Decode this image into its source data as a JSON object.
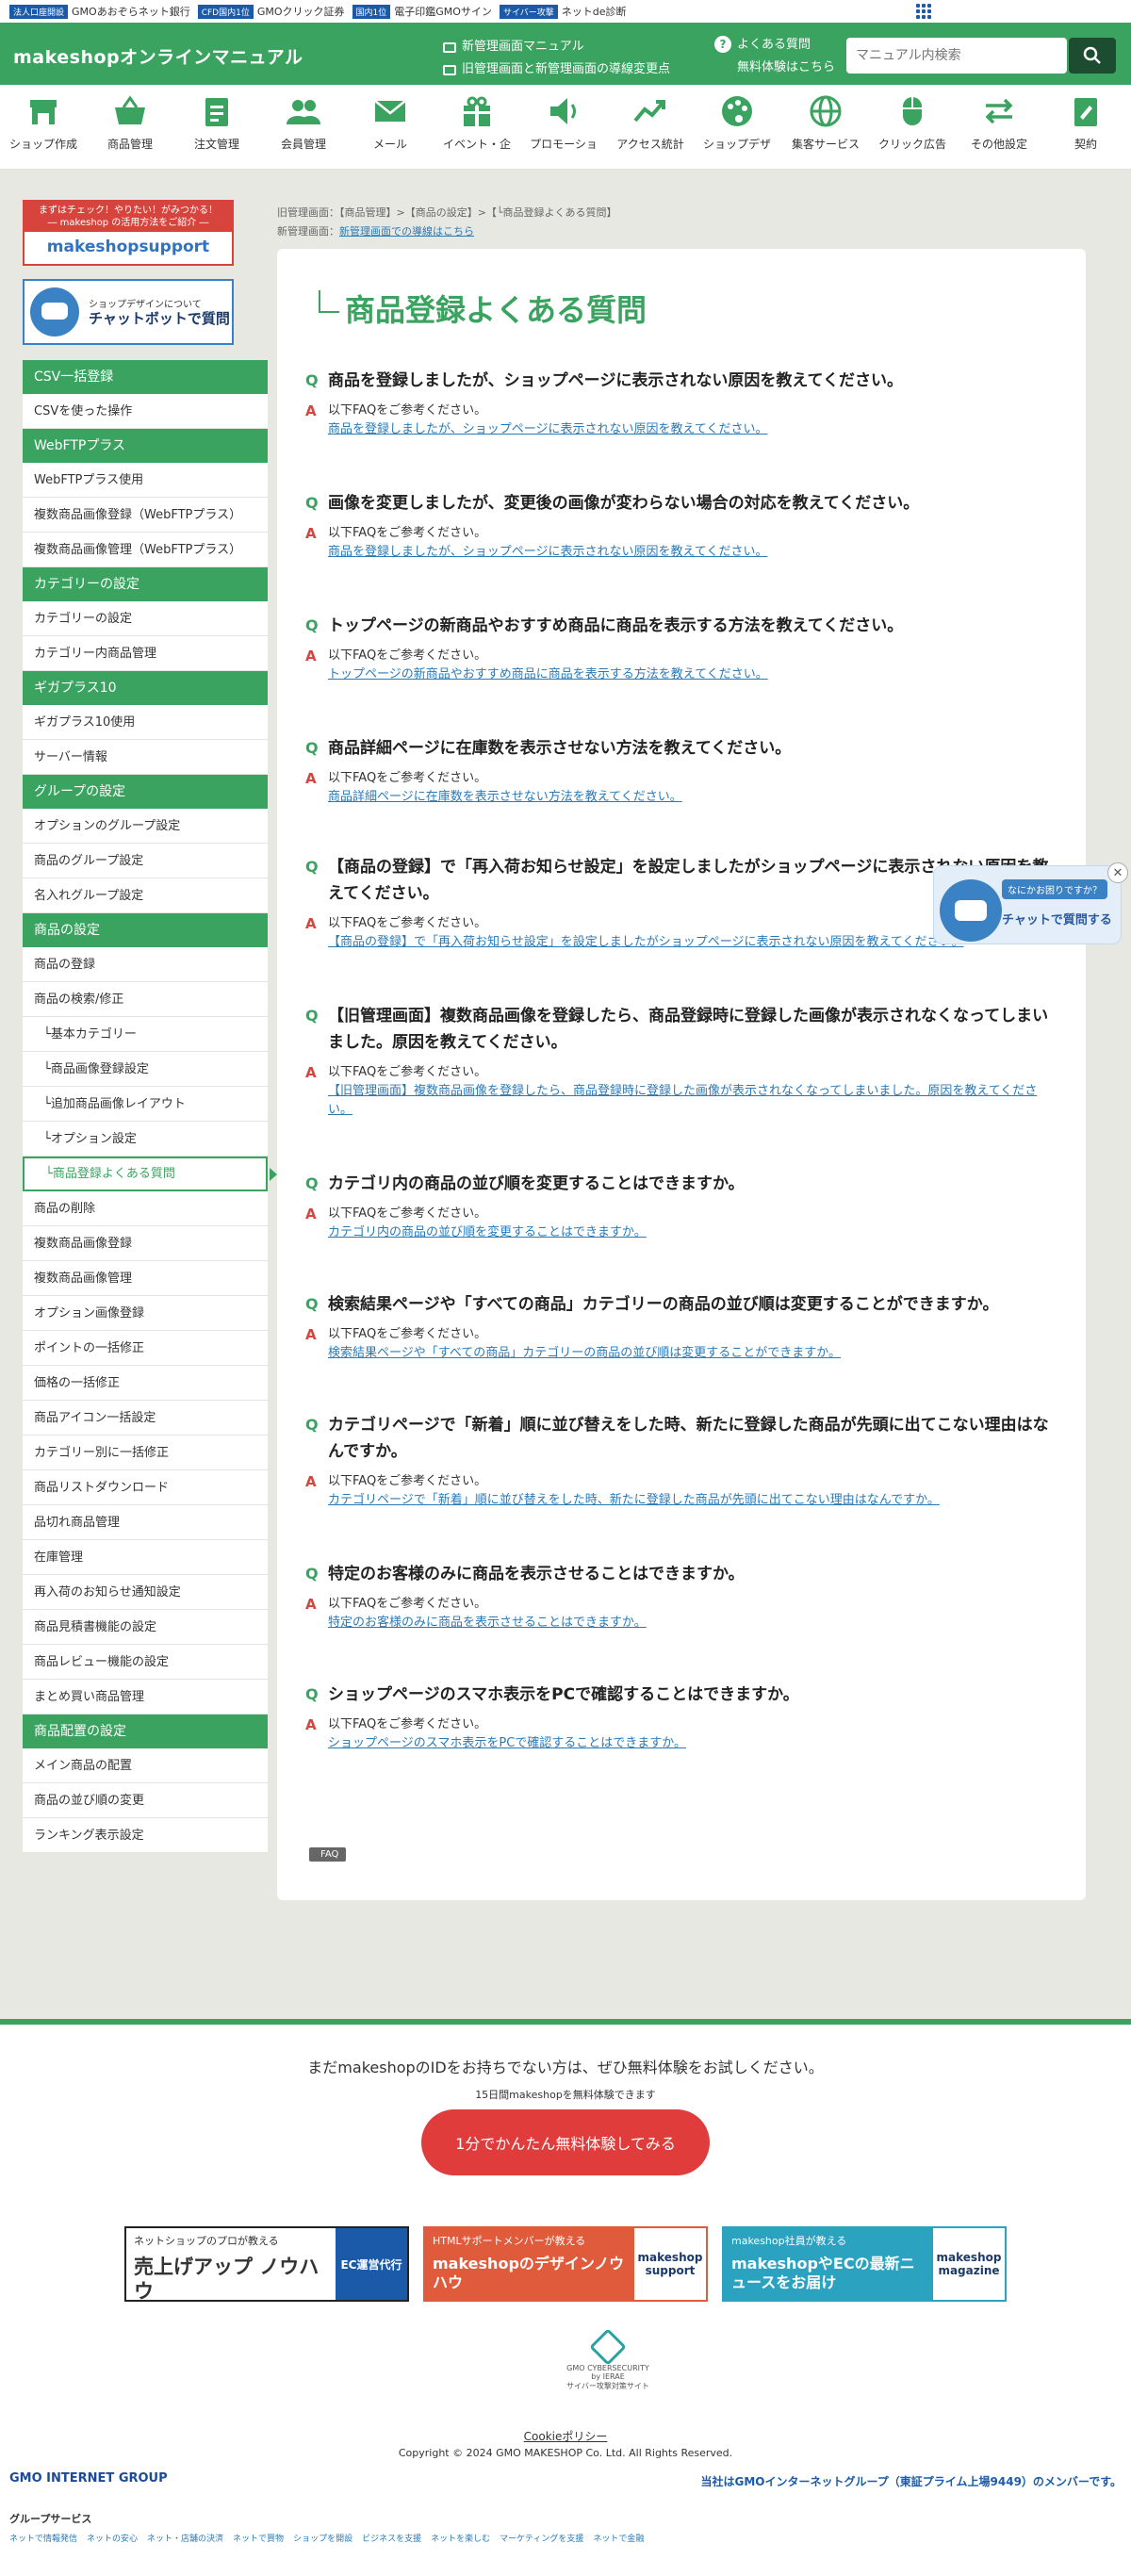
{
  "gmobar": {
    "items": [
      {
        "tag": "法人口座開設",
        "label": "GMOあおぞらネット銀行"
      },
      {
        "tag": "CFD国内1位",
        "label": "GMOクリック証券"
      },
      {
        "tag": "国内1位",
        "label": "電子印鑑GMOサイン"
      },
      {
        "tag": "サイバー攻撃",
        "label": "ネットde診断"
      }
    ]
  },
  "header": {
    "logo": "makeshopオンラインマニュアル",
    "link1": "新管理画面マニュアル",
    "link2": "旧管理画面と新管理画面の導線変更点",
    "faq": "よくある質問",
    "trial": "無料体験はこちら",
    "search_placeholder": "マニュアル内検索"
  },
  "nav": [
    {
      "label": "ショップ作成",
      "icon": "shop-icon"
    },
    {
      "label": "商品管理",
      "icon": "basket-icon"
    },
    {
      "label": "注文管理",
      "icon": "clipboard-icon"
    },
    {
      "label": "会員管理",
      "icon": "users-icon"
    },
    {
      "label": "メール",
      "icon": "mail-icon"
    },
    {
      "label": "イベント・企",
      "icon": "gift-icon"
    },
    {
      "label": "プロモーショ",
      "icon": "speaker-icon"
    },
    {
      "label": "アクセス統計",
      "icon": "chart-icon"
    },
    {
      "label": "ショップデザ",
      "icon": "palette-icon"
    },
    {
      "label": "集客サービス",
      "icon": "globe-icon"
    },
    {
      "label": "クリック広告",
      "icon": "mouse-icon"
    },
    {
      "label": "その他設定",
      "icon": "arrows-icon"
    },
    {
      "label": "契約",
      "icon": "contract-icon"
    }
  ],
  "banners": {
    "b1_top": "まずはチェック！やりたい！がみつかる！",
    "b1_sub": "― makeshop の活用方法をご紹介 ―",
    "b1_brand": "makeshop",
    "b1_brand2": "support",
    "b2_line1": "ショップデザインについて",
    "b2_line2": "チャットボットで質問"
  },
  "sidebar": [
    {
      "type": "sec",
      "label": "CSV一括登録"
    },
    {
      "type": "itm",
      "label": "CSVを使った操作"
    },
    {
      "type": "sec",
      "label": "WebFTPプラス"
    },
    {
      "type": "itm",
      "label": "WebFTPプラス使用"
    },
    {
      "type": "itm",
      "label": "複数商品画像登録（WebFTPプラス）"
    },
    {
      "type": "itm",
      "label": "複数商品画像管理（WebFTPプラス）"
    },
    {
      "type": "sec",
      "label": "カテゴリーの設定"
    },
    {
      "type": "itm",
      "label": "カテゴリーの設定"
    },
    {
      "type": "itm",
      "label": "カテゴリー内商品管理"
    },
    {
      "type": "sec",
      "label": "ギガプラス10"
    },
    {
      "type": "itm",
      "label": "ギガプラス10使用"
    },
    {
      "type": "itm",
      "label": "サーバー情報"
    },
    {
      "type": "sec",
      "label": "グループの設定"
    },
    {
      "type": "itm",
      "label": "オプションのグループ設定"
    },
    {
      "type": "itm",
      "label": "商品のグループ設定"
    },
    {
      "type": "itm",
      "label": "名入れグループ設定"
    },
    {
      "type": "sec",
      "label": "商品の設定"
    },
    {
      "type": "itm",
      "label": "商品の登録"
    },
    {
      "type": "itm",
      "label": "商品の検索/修正"
    },
    {
      "type": "sub",
      "label": "└基本カテゴリー"
    },
    {
      "type": "sub",
      "label": "└商品画像登録設定"
    },
    {
      "type": "sub",
      "label": "└追加商品画像レイアウト"
    },
    {
      "type": "sub",
      "label": "└オプション設定"
    },
    {
      "type": "active",
      "label": "└商品登録よくある質問"
    },
    {
      "type": "itm",
      "label": "商品の削除"
    },
    {
      "type": "itm",
      "label": "複数商品画像登録"
    },
    {
      "type": "itm",
      "label": "複数商品画像管理"
    },
    {
      "type": "itm",
      "label": "オプション画像登録"
    },
    {
      "type": "itm",
      "label": "ポイントの一括修正"
    },
    {
      "type": "itm",
      "label": "価格の一括修正"
    },
    {
      "type": "itm",
      "label": "商品アイコン一括設定"
    },
    {
      "type": "itm",
      "label": "カテゴリー別に一括修正"
    },
    {
      "type": "itm",
      "label": "商品リストダウンロード"
    },
    {
      "type": "itm",
      "label": "品切れ商品管理"
    },
    {
      "type": "itm",
      "label": "在庫管理"
    },
    {
      "type": "itm",
      "label": "再入荷のお知らせ通知設定"
    },
    {
      "type": "itm",
      "label": "商品見積書機能の設定"
    },
    {
      "type": "itm",
      "label": "商品レビュー機能の設定"
    },
    {
      "type": "itm",
      "label": "まとめ買い商品管理"
    },
    {
      "type": "sec",
      "label": "商品配置の設定"
    },
    {
      "type": "itm",
      "label": "メイン商品の配置"
    },
    {
      "type": "itm",
      "label": "商品の並び順の変更"
    },
    {
      "type": "itm",
      "label": "ランキング表示設定"
    }
  ],
  "breadcrumb": {
    "line1": "旧管理画面：【商品管理】>【商品の設定】>【└商品登録よくある質問】",
    "line2_prefix": "新管理画面：",
    "line2_link": "新管理画面での導線はこちら"
  },
  "page": {
    "title": "商品登録よくある質問",
    "q_mark": "Q",
    "a_mark": "A",
    "answer_prefix": "以下FAQをご参考ください。",
    "tag": "FAQ"
  },
  "faqs": [
    {
      "q": "商品を登録しましたが、ショップページに表示されない原因を教えてください。",
      "link": "商品を登録しましたが、ショップページに表示されない原因を教えてください。"
    },
    {
      "q": "画像を変更しましたが、変更後の画像が変わらない場合の対応を教えてください。",
      "link": "商品を登録しましたが、ショップページに表示されない原因を教えてください。"
    },
    {
      "q": "トップページの新商品やおすすめ商品に商品を表示する方法を教えてください。",
      "link": "トップページの新商品やおすすめ商品に商品を表示する方法を教えてください。"
    },
    {
      "q": "商品詳細ページに在庫数を表示させない方法を教えてください。",
      "link": "商品詳細ページに在庫数を表示させない方法を教えてください。"
    },
    {
      "q": "【商品の登録】で「再入荷お知らせ設定」を設定しましたがショップページに表示されない原因を教えてください。",
      "link": "【商品の登録】で「再入荷お知らせ設定」を設定しましたがショップページに表示されない原因を教えてください。"
    },
    {
      "q": "【旧管理画面】複数商品画像を登録したら、商品登録時に登録した画像が表示されなくなってしまいました。原因を教えてください。",
      "link": "【旧管理画面】複数商品画像を登録したら、商品登録時に登録した画像が表示されなくなってしまいました。原因を教えてください。"
    },
    {
      "q": "カテゴリ内の商品の並び順を変更することはできますか。",
      "link": "カテゴリ内の商品の並び順を変更することはできますか。"
    },
    {
      "q": "検索結果ページや「すべての商品」カテゴリーの商品の並び順は変更することができますか。",
      "link": "検索結果ページや「すべての商品」カテゴリーの商品の並び順は変更することができますか。"
    },
    {
      "q": "カテゴリページで「新着」順に並び替えをした時、新たに登録した商品が先頭に出てこない理由はなんですか。",
      "link": "カテゴリページで「新着」順に並び替えをした時、新たに登録した商品が先頭に出てこない理由はなんですか。"
    },
    {
      "q": "特定のお客様のみに商品を表示させることはできますか。",
      "link": "特定のお客様のみに商品を表示させることはできますか。"
    },
    {
      "q": "ショップページのスマホ表示をPCで確認することはできますか。",
      "link": "ショップページのスマホ表示をPCで確認することはできますか。"
    }
  ],
  "floatbot": {
    "bubble": "なにかお困りですか？",
    "label": "チャットで質問する"
  },
  "footer": {
    "cta1": "まだmakeshopのIDをお持ちでない方は、ぜひ無料体験をお試しください。",
    "cta2": "15日間makeshopを無料体験できます",
    "button": "1分でかんたん無料体験してみる",
    "ban1_top": "ネットショップのプロが教える",
    "ban1_main": "売上げアップ ノウハウ",
    "ban1_side": "EC運営代行",
    "ban2_top": "HTMLサポートメンバーが教える",
    "ban2_main": "makeshopのデザインノウハウ",
    "ban2_side": "makeshop support",
    "ban3_top": "makeshop社員が教える",
    "ban3_main": "makeshopやECの最新ニュースをお届け",
    "ban3_side": "makeshop magazine",
    "cyber1": "GMO CYBERSECURITY by IERAE",
    "cyber2": "サイバー攻撃対策サイト",
    "cookie": "Cookieポリシー",
    "copyright": "Copyright © 2024 GMO MAKESHOP Co. Ltd. All Rights Reserved.",
    "gmo": "GMO INTERNET GROUP",
    "member": "当社はGMOインターネットグループ（東証プライム上場9449）のメンバーです。",
    "group": "グループサービス",
    "group_links": [
      "ネットで情報発信",
      "ネットの安心",
      "ネット・店舗の決済",
      "ネットで買物",
      "ショップを開設",
      "ビジネスを支援",
      "ネットを楽しむ",
      "マーケティングを支援",
      "ネットで金融"
    ]
  },
  "colors": {
    "brand_green": "#3aa35f",
    "link_blue": "#2a7ab8",
    "answer_red": "#d7443e",
    "cta_red": "#e03c3c"
  }
}
